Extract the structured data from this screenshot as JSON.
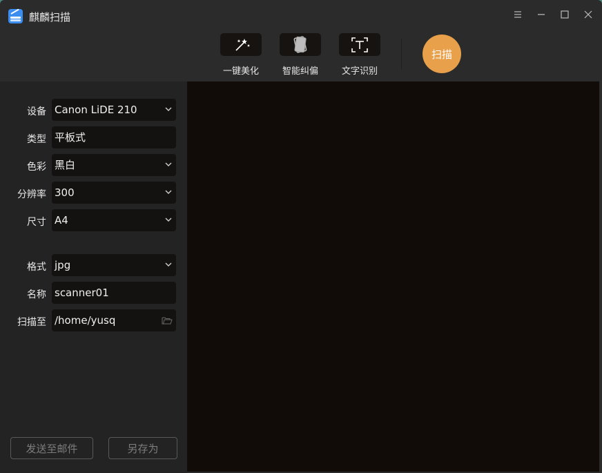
{
  "app": {
    "title": "麒麟扫描"
  },
  "toolbar": {
    "beautify_label": "一键美化",
    "rectify_label": "智能纠偏",
    "ocr_label": "文字识别",
    "scan_label": "扫描"
  },
  "settings": {
    "device": {
      "label": "设备",
      "value": "Canon LiDE 210"
    },
    "type": {
      "label": "类型",
      "value": "平板式"
    },
    "color": {
      "label": "色彩",
      "value": "黑白"
    },
    "resolution": {
      "label": "分辨率",
      "value": "300"
    },
    "size": {
      "label": "尺寸",
      "value": "A4"
    },
    "format": {
      "label": "格式",
      "value": "jpg"
    },
    "name": {
      "label": "名称",
      "value": "scanner01"
    },
    "save_to": {
      "label": "扫描至",
      "value": "/home/yusq"
    }
  },
  "actions": {
    "send_mail_label": "发送至邮件",
    "save_as_label": "另存为"
  },
  "colors": {
    "accent": "#e8a04a",
    "logo": "#3b8df0",
    "preview_bg": "#120c08"
  },
  "icons": {
    "logo": "scanner-app-icon",
    "beautify": "magic-wand-icon",
    "rectify": "rotate-cards-icon",
    "ocr": "text-recognition-icon",
    "menu": "menu-icon",
    "minimize": "minimize-icon",
    "maximize": "maximize-icon",
    "close": "close-icon",
    "dropdown": "chevron-down-icon",
    "folder": "folder-icon"
  }
}
